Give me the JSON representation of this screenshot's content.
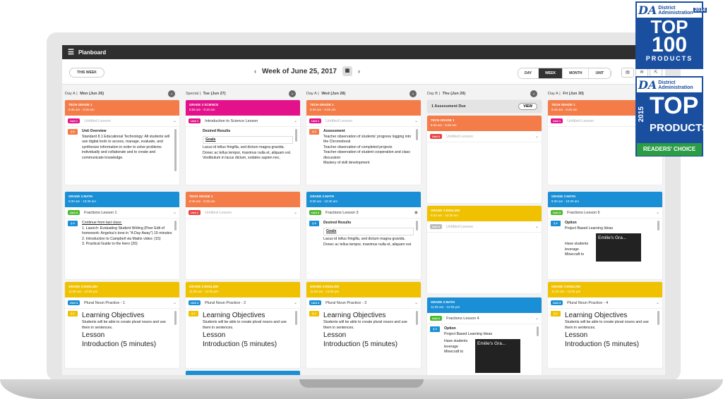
{
  "app": {
    "title": "Planboard"
  },
  "toolbar": {
    "this_week": "THIS WEEK",
    "week_label": "Week of June 25, 2017",
    "views": [
      "DAY",
      "WEEK",
      "MONTH",
      "UNIT"
    ],
    "active_view": "WEEK"
  },
  "days": [
    {
      "prefix": "Day A",
      "name": "Mon (Jun 26)"
    },
    {
      "prefix": "Special",
      "name": "Tue (Jun 27)"
    },
    {
      "prefix": "Day A",
      "name": "Wed (Jun 28)"
    },
    {
      "prefix": "Day B",
      "name": "Thu (Jun 29)"
    },
    {
      "prefix": "Day A",
      "name": "Fri (Jun 30)"
    }
  ],
  "colors": {
    "tech": "#f47c48",
    "science": "#e4128a",
    "math": "#1a8fd6",
    "english": "#efc100",
    "green": "#4cba2e",
    "red": "#e8423f"
  },
  "mon": {
    "c1": {
      "class": "TECH GRADE 1",
      "time": "8:45 am - 9:25 am",
      "unit": "Unit 1",
      "lesson": "Untitled Lesson",
      "tag": "§ 6",
      "l1": "Unit Overview",
      "l2": "Standard 8.1 Educational Technology: All students will use digital tools to access, manage, evaluate, and synthesize information in order to solve problems individually and collaborate and to create and communicate knowledge."
    },
    "c2": {
      "class": "GRADE 3 MATH",
      "time": "9:30 am - 10:30 am",
      "unit": "Unit 3",
      "lesson": "Fractions Lesson 1",
      "tag": "§ 3",
      "l1": "Continue from last class:",
      "items": [
        "1. Launch: Evaluating Student Writing (Peer Edit of homework: Angelou's tone in \"A Day Away\") 15 minutes",
        "2. Introduction to Campbell via Matrix video: (15)",
        "3. Practical Guide to the Hero (20)"
      ]
    },
    "c3": {
      "class": "GRADE 3 ENGLISH",
      "time": "11:00 am - 12:05 pm",
      "unit": "Unit 4",
      "lesson": "Plural Noun Practice - 1",
      "tag": "§ 2",
      "h1": "Learning Objectives",
      "p1": "Students will be able to create plural nouns and use them in sentences.",
      "h2": "Lesson",
      "h3": "Introduction (5 minutes)"
    }
  },
  "tue": {
    "c1": {
      "class": "GRADE 3 SCIENCE",
      "time": "6:55 am - 8:10 am",
      "unit": "Unit 1",
      "lesson": "Introduction to Science Lesson",
      "tag": "§ 3",
      "l1": "Desired Results",
      "goals": "Goals",
      "items": [
        "Lacus id tellus fringilla, sed dictum magna gravida.",
        "Donec ac tellus tempor, maximus nulla et, aliquam est.",
        "Vestibulum in lacus dictum, sodales sapien nec,"
      ]
    },
    "c2": {
      "class": "TECH GRADE 1",
      "time": "8:45 am - 9:25 am",
      "unit": "Unit 2",
      "lesson": "Untitled Lesson"
    },
    "c3": {
      "class": "GRADE 3 ENGLISH",
      "time": "11:00 am - 12:05 pm",
      "unit": "Unit 4",
      "lesson": "Plural Noun Practice - 2",
      "tag": "§ 2",
      "h1": "Learning Objectives",
      "p1": "Students will be able to create plural nouns and use them in sentences.",
      "h2": "Lesson",
      "h3": "Introduction (5 minutes)"
    }
  },
  "wed": {
    "c1": {
      "class": "TECH GRADE 1",
      "time": "8:45 am - 9:25 am",
      "unit": "Unit 1",
      "lesson": "Untitled Lesson",
      "tag": "§ 3",
      "l1": "Assessment",
      "l2": "Teacher observation of students' progress logging into the Chromebook",
      "l3": "Teacher observation of completed projects",
      "l4": "Teacher observation of student cooperation and class discussion",
      "l5": "Mastery of skill development"
    },
    "c2": {
      "class": "GRADE 3 MATH",
      "time": "9:30 am - 10:30 am",
      "unit": "Unit 3",
      "lesson": "Fractions Lesson 3",
      "tag": "§ 3",
      "l1": "Desired Results",
      "goals": "Goals",
      "items": [
        "Lacus id tellus fringilla, sed dictum magna gravida.",
        "Donec ac tellus tempor, maximus nulla et, aliquam est."
      ]
    },
    "c3": {
      "class": "GRADE 3 ENGLISH",
      "time": "11:00 am - 12:05 pm",
      "unit": "Unit 4",
      "lesson": "Plural Noun Practice - 3",
      "tag": "§ 2",
      "h1": "Learning Objectives",
      "p1": "Students will be able to create plural nouns and use them in sentences.",
      "h2": "Lesson",
      "h3": "Introduction (5 minutes)"
    }
  },
  "thu": {
    "due": "1 Assessment Due",
    "view": "VIEW",
    "c1": {
      "class": "TECH GRADE 1",
      "time": "8:45 am - 9:25 am",
      "unit": "Unit 2",
      "lesson": "Untitled Lesson"
    },
    "c2": {
      "class": "GRADE 3 ENGLISH",
      "time": "9:30 am - 10:30 am",
      "unit": "Unit 4",
      "lesson": "Untitled Lesson"
    },
    "c3": {
      "class": "GRADE 3 MATH",
      "time": "11:05 am - 12:05 pm",
      "unit": "Unit 2",
      "lesson": "Fractions Lesson 4",
      "tag": "§ 3",
      "l1": "Option",
      "l2": "Project Based Learning Ideas",
      "l3": "Have students leverage Minecraft to",
      "video": "Emilie's Gra..."
    }
  },
  "fri": {
    "c1": {
      "class": "TECH GRADE 1",
      "time": "8:45 am - 9:25 am",
      "unit": "Unit 1",
      "lesson": "Untitled Lesson"
    },
    "c2": {
      "class": "GRADE 3 MATH",
      "time": "9:30 am - 10:30 am",
      "unit": "Unit 3",
      "lesson": "Fractions Lesson 5",
      "tag": "§ 2",
      "l1": "Option",
      "l2": "Project Based Learning Ideas",
      "l3": "Have students leverage Minecraft to",
      "video": "Emilie's Gra..."
    },
    "c3": {
      "class": "GRADE 3 ENGLISH",
      "time": "11:00 am - 12:05 pm",
      "unit": "Unit 4",
      "lesson": "Plural Noun Practice - 4",
      "tag": "§ 2",
      "h1": "Learning Objectives",
      "p1": "Students will be able to create plural nouns and use them in sentences.",
      "h2": "Lesson",
      "h3": "Introduction (5 minutes)"
    }
  },
  "badges": {
    "b1": {
      "brand": "DA",
      "l1": "District",
      "l2": "Administration",
      "year": "2014",
      "big1": "TOP",
      "big2": "100",
      "foot": "PRODUCTS"
    },
    "b2": {
      "brand": "DA",
      "l1": "District",
      "l2": "Administration",
      "year": "2015",
      "big1": "TOP",
      "big2": "PRODUCTS",
      "foot": "READERS' CHOICE"
    }
  }
}
